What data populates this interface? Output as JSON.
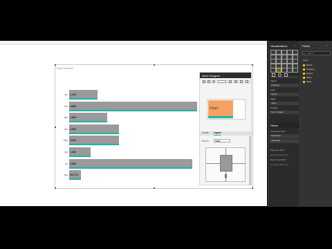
{
  "report": {
    "visual_title": "Sales by Month"
  },
  "chart_data": {
    "type": "bar",
    "categories": [
      "Jan",
      "Feb",
      "Mar",
      "Apr",
      "May",
      "Jun",
      "Jul",
      "Aug"
    ],
    "values": [
      1.2,
      5.4,
      1.6,
      2.1,
      2.1,
      0.9,
      5.2,
      0.5
    ],
    "value_labels": [
      "1.21M",
      "4.86M",
      "1.80M",
      "2.55M",
      "3.04M",
      "1.33M",
      "6.28M",
      "951.77K"
    ],
    "series": [
      {
        "name": "Sales",
        "values": [
          1.2,
          5.4,
          1.6,
          2.1,
          2.1,
          0.9,
          5.2,
          0.5
        ]
      }
    ]
  },
  "mark_designer": {
    "title": "Mark Designer",
    "preview_text": "Chart",
    "tabs": [
      "Details",
      "Layout"
    ],
    "bind_to_label": "Bind to",
    "bind_to_value": "Value"
  },
  "visualizations": {
    "title": "Visualizations",
    "sections": [
      "Values",
      "Field",
      "Value",
      "Tooltips"
    ],
    "wells": [
      "Category",
      "Month",
      "Value",
      "Sum of Sales"
    ],
    "filters_title": "Filters",
    "filters": [
      "Visual level filters",
      "Month(All)",
      "Value(All)",
      "Page level filters",
      "Drag data fields here",
      "Report level filters",
      "Drag data fields here"
    ]
  },
  "fields": {
    "title": "Fields",
    "search_placeholder": "Search",
    "table_name": "Sales",
    "items": [
      "Month",
      "Category",
      "Region",
      "Sales",
      "Value"
    ]
  },
  "colors": {
    "bar": "#9a9a9a",
    "accent": "#19b6a7",
    "brand_yellow": "#f2c811"
  }
}
